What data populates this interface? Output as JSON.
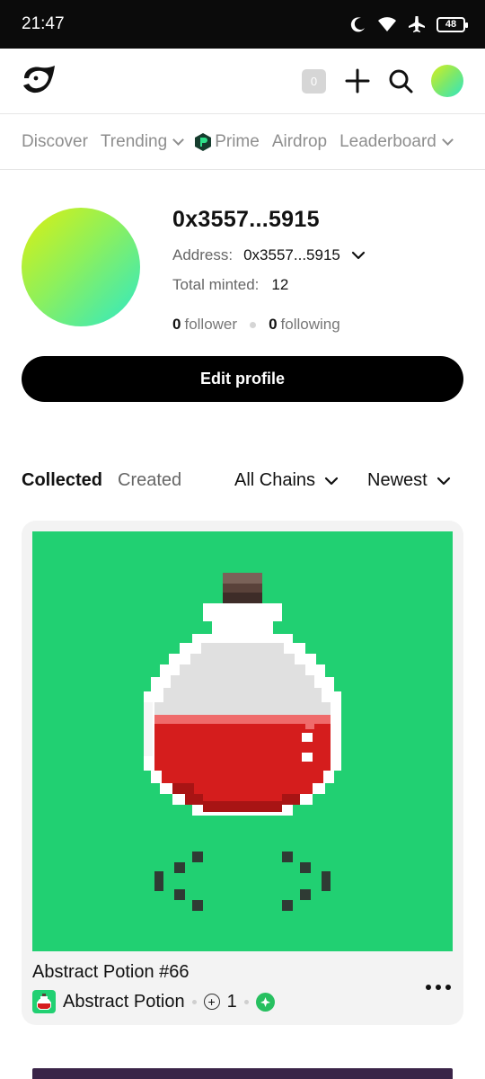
{
  "status_bar": {
    "time": "21:47",
    "battery": "48"
  },
  "app_bar": {
    "notification_count": "0"
  },
  "nav": {
    "items": [
      {
        "label": "Discover"
      },
      {
        "label": "Trending"
      },
      {
        "label": "Prime"
      },
      {
        "label": "Airdrop"
      },
      {
        "label": "Leaderboard"
      }
    ]
  },
  "profile": {
    "name": "0x3557...5915",
    "address_label": "Address:",
    "address_value": "0x3557...5915",
    "minted_label": "Total minted:",
    "minted_value": "12",
    "follower_count": "0",
    "follower_label": "follower",
    "following_count": "0",
    "following_label": "following",
    "edit_label": "Edit profile"
  },
  "tabs": {
    "collected": "Collected",
    "created": "Created",
    "chains_filter": "All Chains",
    "sort": "Newest"
  },
  "nft": {
    "title": "Abstract Potion #66",
    "collection": "Abstract Potion",
    "count": "1",
    "colors": {
      "background": "#21d072",
      "liquid": "#d51d1d",
      "glass": "#e2e2e2"
    }
  },
  "colors": {
    "accent": "#000000",
    "muted": "#8e8e8e"
  }
}
